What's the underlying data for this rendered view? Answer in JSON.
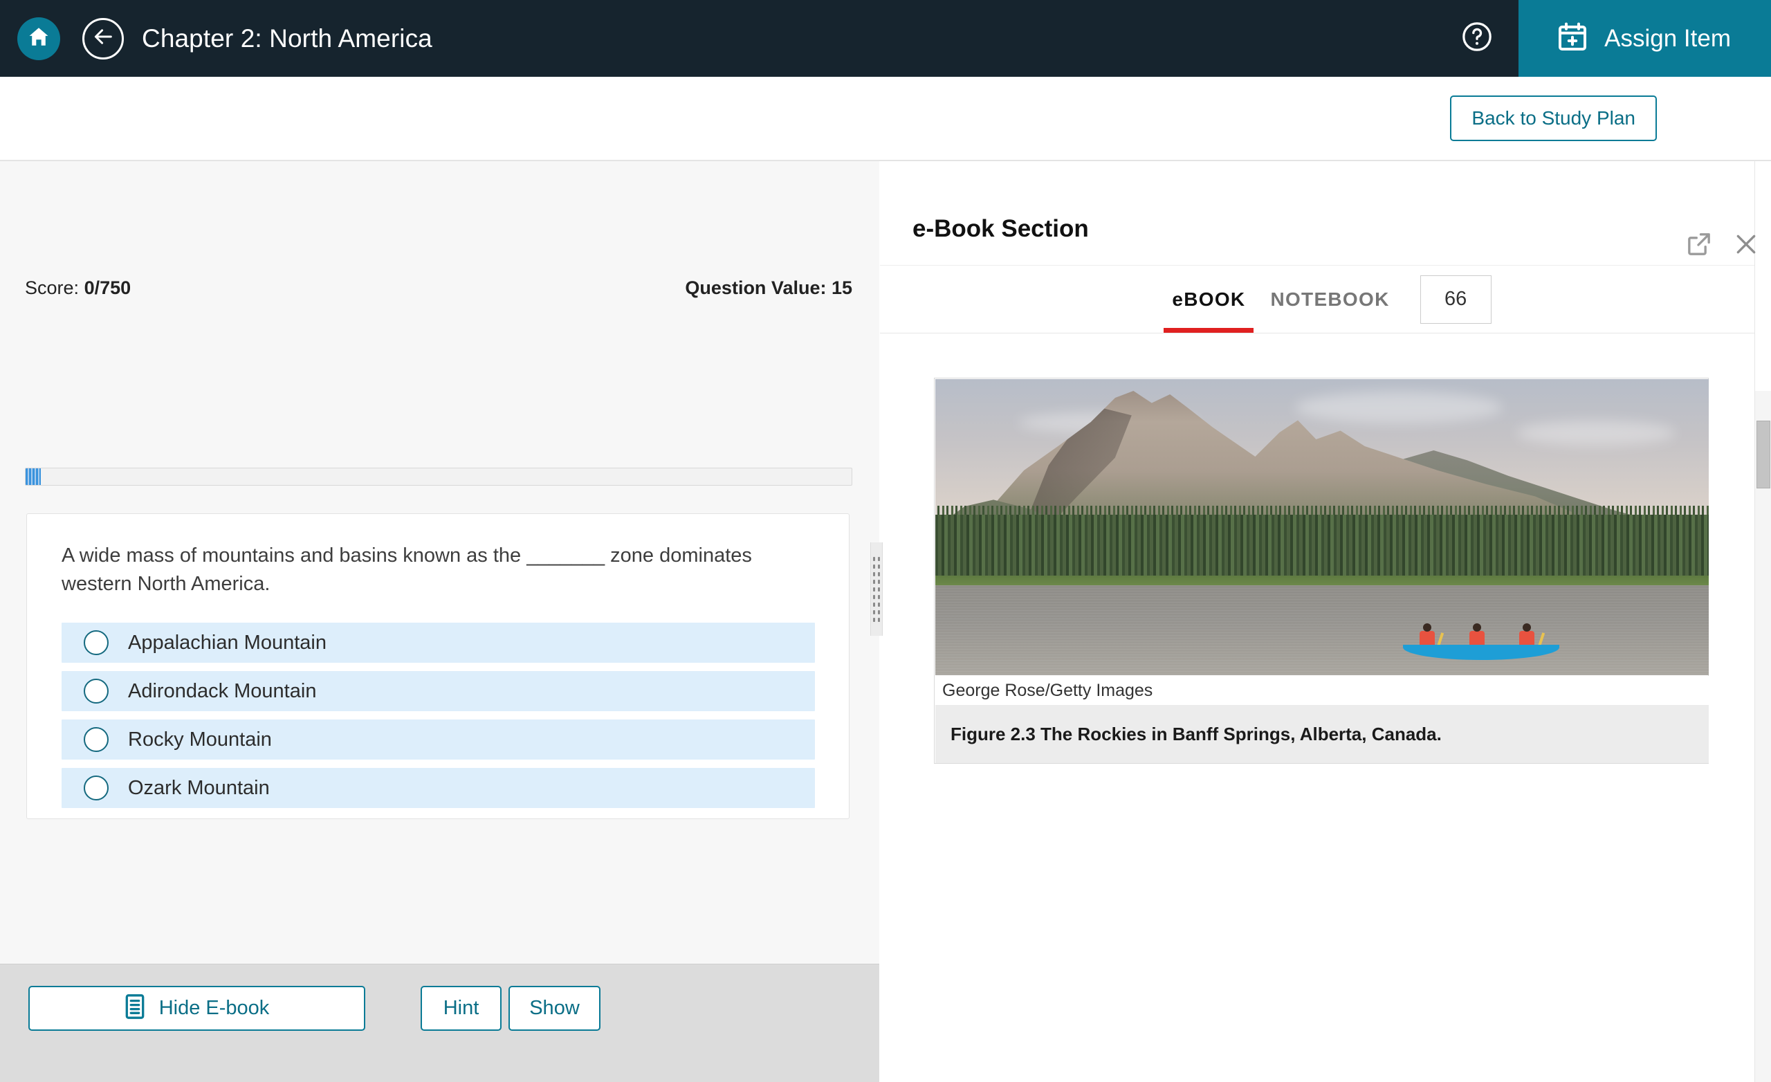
{
  "topbar": {
    "home_icon": "home-icon",
    "back_icon": "back-arrow-icon",
    "title": "Chapter 2: North America",
    "help_icon": "help-circle-icon",
    "assign_icon": "calendar-plus-icon",
    "assign_label": "Assign Item",
    "bg_color": "#16242e",
    "accent_color": "#0a7b96"
  },
  "subbar": {
    "study_plan_label": "Back to Study Plan"
  },
  "question_panel": {
    "score_label": "Score:",
    "score_value": "0/750",
    "question_value_label": "Question Value: 15",
    "progress_percent": 2,
    "question_text": "A wide mass of mountains and basins known as the _______ zone dominates western North America.",
    "options": [
      {
        "label": "Appalachian Mountain",
        "selected": false
      },
      {
        "label": "Adirondack Mountain",
        "selected": false
      },
      {
        "label": "Rocky Mountain",
        "selected": false
      },
      {
        "label": "Ozark Mountain",
        "selected": false
      }
    ],
    "toolbar": {
      "ebook_icon": "ebook-icon",
      "ebook_label": "Hide E-book",
      "hint_label": "Hint",
      "show_label": "Show"
    }
  },
  "ebook_panel": {
    "title": "e-Book Section",
    "popout_icon": "external-link-icon",
    "close_icon": "close-icon",
    "tabs": [
      {
        "label": "eBOOK",
        "active": true
      },
      {
        "label": "NOTEBOOK",
        "active": false
      }
    ],
    "active_tab_underline_color": "#e02020",
    "page_number": "66",
    "figure": {
      "credit": "George Rose/Getty Images",
      "caption": "Figure 2.3 The Rockies in Banff Springs, Alberta, Canada.",
      "alt": "Mountain over a lake with a canoe carrying three paddlers"
    }
  }
}
